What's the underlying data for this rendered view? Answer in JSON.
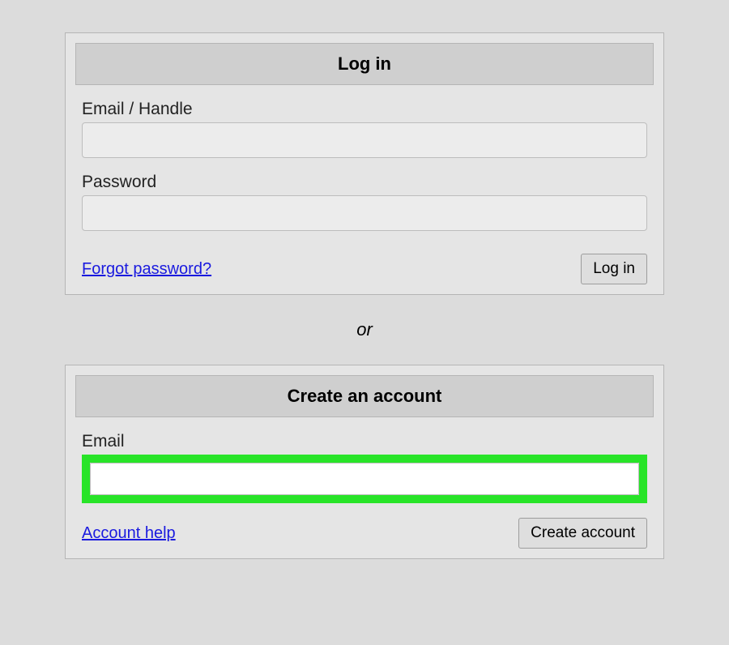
{
  "login": {
    "title": "Log in",
    "email_label": "Email / Handle",
    "email_value": "",
    "password_label": "Password",
    "password_value": "",
    "forgot_link": "Forgot password?",
    "submit_label": "Log in"
  },
  "divider": "or",
  "create": {
    "title": "Create an account",
    "email_label": "Email",
    "email_value": "",
    "help_link": "Account help",
    "submit_label": "Create account"
  }
}
